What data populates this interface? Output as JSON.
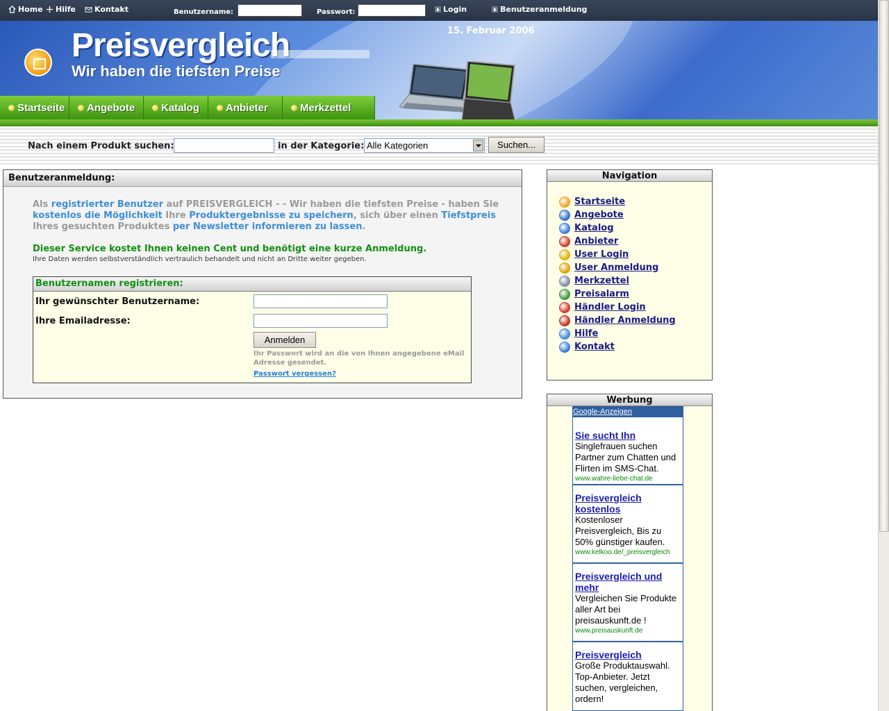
{
  "topbar": {
    "home": "Home",
    "help": "Hilfe",
    "contact": "Kontakt",
    "username_label": "Benutzername:",
    "password_label": "Passwort:",
    "login": "Login",
    "register": "Benutzeranmeldung"
  },
  "header": {
    "date": "15. Februar 2006",
    "brand_title": "Preisvergleich",
    "brand_subtitle": "Wir haben die tiefsten Preise"
  },
  "nav": {
    "items": [
      {
        "label": "Startseite"
      },
      {
        "label": "Angebote"
      },
      {
        "label": "Katalog"
      },
      {
        "label": "Anbieter"
      },
      {
        "label": "Merkzettel"
      }
    ]
  },
  "search": {
    "label": "Nach einem Produkt suchen:",
    "category_label": "in der Kategorie:",
    "category_value": "Alle Kategorien",
    "button": "Suchen..."
  },
  "main": {
    "title": "Benutzeranmeldung:",
    "intro": [
      {
        "t": "Als ",
        "c": "g"
      },
      {
        "t": "registrierter Benutzer",
        "c": "b"
      },
      {
        "t": " auf PREISVERGLEICH - - Wir haben die tiefsten Preise - haben Sie ",
        "c": "g"
      },
      {
        "t": "kostenlos die Möglichkeit",
        "c": "b"
      },
      {
        "t": " Ihre ",
        "c": "g"
      },
      {
        "t": "Produktergebnisse zu speichern",
        "c": "b"
      },
      {
        "t": ", sich über einen ",
        "c": "g"
      },
      {
        "t": "Tiefstpreis",
        "c": "b"
      },
      {
        "t": " Ihres gesuchten Produktes ",
        "c": "g"
      },
      {
        "t": "per Newsletter informieren zu lassen",
        "c": "b"
      },
      {
        "t": ".",
        "c": "g"
      }
    ],
    "service_note": "Dieser Service kostet Ihnen keinen Cent und benötigt eine kurze Anmeldung.",
    "privacy_note": "Ihre Daten werden selbstverständlich vertraulich behandelt und nicht an Dritte weiter gegeben.",
    "register": {
      "title": "Benutzernamen registrieren:",
      "username_label": "Ihr gewünschter Benutzername:",
      "email_label": "Ihre Emailadresse:",
      "submit": "Anmelden",
      "note": "Ihr Passwort wird an die von Ihnen angegebene eMail Adresse gesendet.",
      "forgot": "Passwort vergessen?"
    }
  },
  "sidebar": {
    "nav_title": "Navigation",
    "nav_items": [
      {
        "label": "Startseite",
        "icon": "house-icon",
        "color": "#f0a21e"
      },
      {
        "label": "Angebote",
        "icon": "tag-icon",
        "color": "#2f6fd0"
      },
      {
        "label": "Katalog",
        "icon": "monitor-icon",
        "color": "#3a7ad8"
      },
      {
        "label": "Anbieter",
        "icon": "globe-icon",
        "color": "#d03a2a"
      },
      {
        "label": "User Login",
        "icon": "key-icon",
        "color": "#e0b000"
      },
      {
        "label": "User Anmeldung",
        "icon": "user-icon",
        "color": "#e0a000"
      },
      {
        "label": "Merkzettel",
        "icon": "notepad-icon",
        "color": "#7a8aa0"
      },
      {
        "label": "Preisalarm",
        "icon": "alarm-icon",
        "color": "#3a9a3a"
      },
      {
        "label": "Händler Login",
        "icon": "shop-icon",
        "color": "#d03a2a"
      },
      {
        "label": "Händler Anmeldung",
        "icon": "case-icon",
        "color": "#c03020"
      },
      {
        "label": "Hilfe",
        "icon": "help-icon",
        "color": "#3a8ad8"
      },
      {
        "label": "Kontakt",
        "icon": "mail-icon",
        "color": "#3a7ad8"
      }
    ],
    "ads_title": "Werbung",
    "ads_header": "Google-Anzeigen",
    "ads": [
      {
        "title": "Sie sucht Ihn",
        "body": "Singlefrauen suchen Partner zum Chatten und Flirten im SMS-Chat.",
        "url": "www.wahre-liebe-chat.de"
      },
      {
        "title": "Preisvergleich kostenlos",
        "body": "Kostenloser Preisvergleich, Bis zu 50% günstiger kaufen.",
        "url": "www.kelkoo.de/_preisvergleich"
      },
      {
        "title": "Preisvergleich und mehr",
        "body": "Vergleichen Sie Produkte aller Art bei preisauskunft.de !",
        "url": "www.preisauskunft.de"
      },
      {
        "title": "Preisvergleich",
        "body": "Große Produktauswahl. Top-Anbieter. Jetzt suchen, vergleichen, ordern!",
        "url": ""
      }
    ]
  }
}
